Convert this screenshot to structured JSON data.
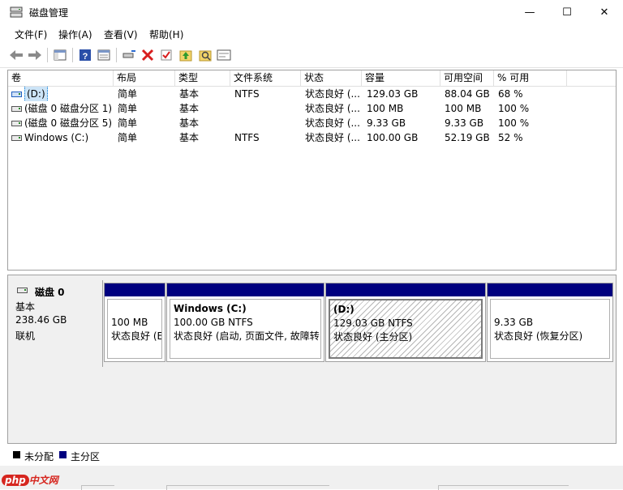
{
  "window": {
    "title": "磁盘管理",
    "minimize": "—",
    "maximize": "☐",
    "close": "✕"
  },
  "menu": [
    "文件(F)",
    "操作(A)",
    "查看(V)",
    "帮助(H)"
  ],
  "toolbar": {
    "icons": [
      "back-icon",
      "forward-icon",
      "console-tree-icon",
      "help-icon",
      "properties-icon",
      "connect-icon",
      "delete-icon",
      "check-icon",
      "up-icon",
      "search-icon",
      "rescan-icon"
    ]
  },
  "table": {
    "columns": [
      "卷",
      "布局",
      "类型",
      "文件系统",
      "状态",
      "容量",
      "可用空间",
      "% 可用"
    ],
    "rows": [
      [
        "(D:)",
        "简单",
        "基本",
        "NTFS",
        "状态良好 (...",
        "129.03 GB",
        "88.04 GB",
        "68 %"
      ],
      [
        "(磁盘 0 磁盘分区 1)",
        "简单",
        "基本",
        "",
        "状态良好 (...",
        "100 MB",
        "100 MB",
        "100 %"
      ],
      [
        "(磁盘 0 磁盘分区 5)",
        "简单",
        "基本",
        "",
        "状态良好 (...",
        "9.33 GB",
        "9.33 GB",
        "100 %"
      ],
      [
        "Windows (C:)",
        "简单",
        "基本",
        "NTFS",
        "状态良好 (...",
        "100.00 GB",
        "52.19 GB",
        "52 %"
      ]
    ]
  },
  "disk": {
    "name": "磁盘 0",
    "type": "基本",
    "size": "238.46 GB",
    "status": "联机"
  },
  "partitions": [
    {
      "title": "",
      "line1": "100 MB",
      "line2": "状态良好 (E"
    },
    {
      "title": "Windows  (C:)",
      "line1": "100.00 GB NTFS",
      "line2": "状态良好 (启动, 页面文件, 故障转"
    },
    {
      "title": "(D:)",
      "line1": "129.03 GB NTFS",
      "line2": "状态良好 (主分区)"
    },
    {
      "title": "",
      "line1": "9.33 GB",
      "line2": "状态良好 (恢复分区)"
    }
  ],
  "legend": [
    {
      "label": "未分配",
      "color": "#000000"
    },
    {
      "label": "主分区",
      "color": "#00007f"
    }
  ],
  "watermark": {
    "badge": "php",
    "text": "中文网"
  },
  "colors": {
    "partition_header": "#00007f",
    "selection": "#cce4f7",
    "delete_red": "#d81e1e"
  }
}
